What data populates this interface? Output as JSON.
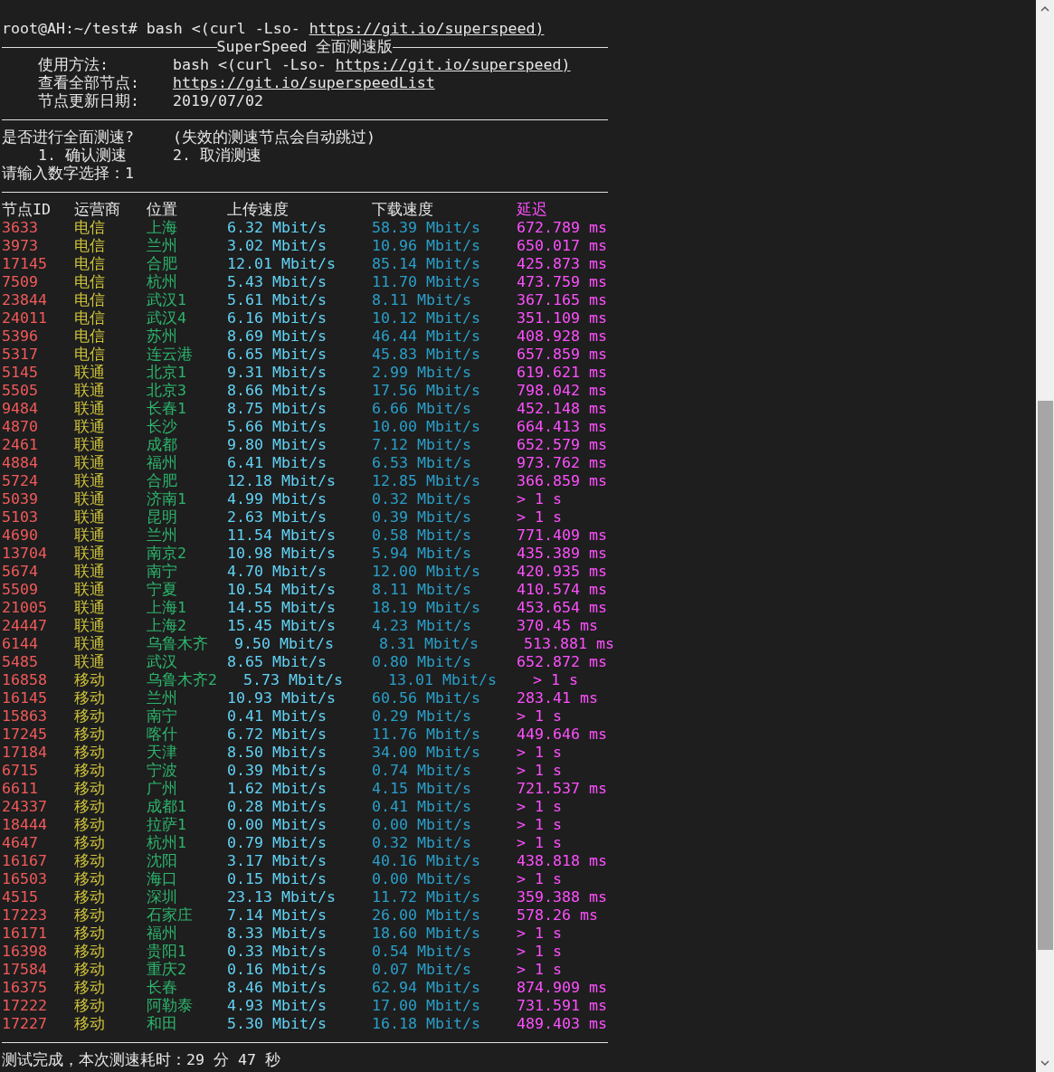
{
  "prompt_line": {
    "command": "root@AH:~/test# bash <(curl -Lso- ",
    "link": "https://git.io/superspeed)"
  },
  "banner_title": "SuperSpeed 全面测速版",
  "info": [
    {
      "label": "使用方法:",
      "value": "bash <(curl -Lso- ",
      "link": "https://git.io/superspeed)"
    },
    {
      "label": "查看全部节点:",
      "link": "https://git.io/superspeedList"
    },
    {
      "label": "节点更新日期:",
      "value": "2019/07/02"
    }
  ],
  "question": {
    "text": "是否进行全面测速?",
    "note": "(失效的测速节点会自动跳过)"
  },
  "options": [
    "1. 确认测速",
    "2. 取消测速"
  ],
  "input_prompt": {
    "label": "请输入数字选择：",
    "value": "1"
  },
  "table": {
    "columns": [
      "节点ID",
      "运营商",
      "位置",
      "上传速度",
      "下载速度",
      "延迟"
    ],
    "rows": [
      [
        "3633",
        "电信",
        "上海",
        "6.32 Mbit/s",
        "58.39 Mbit/s",
        "672.789 ms"
      ],
      [
        "3973",
        "电信",
        "兰州",
        "3.02 Mbit/s",
        "10.96 Mbit/s",
        "650.017 ms"
      ],
      [
        "17145",
        "电信",
        "合肥",
        "12.01 Mbit/s",
        "85.14 Mbit/s",
        "425.873 ms"
      ],
      [
        "7509",
        "电信",
        "杭州",
        "5.43 Mbit/s",
        "11.70 Mbit/s",
        "473.759 ms"
      ],
      [
        "23844",
        "电信",
        "武汉1",
        "5.61 Mbit/s",
        "8.11 Mbit/s",
        "367.165 ms"
      ],
      [
        "24011",
        "电信",
        "武汉4",
        "6.16 Mbit/s",
        "10.12 Mbit/s",
        "351.109 ms"
      ],
      [
        "5396",
        "电信",
        "苏州",
        "8.69 Mbit/s",
        "46.44 Mbit/s",
        "408.928 ms"
      ],
      [
        "5317",
        "电信",
        "连云港",
        "6.65 Mbit/s",
        "45.83 Mbit/s",
        "657.859 ms"
      ],
      [
        "5145",
        "联通",
        "北京1",
        "9.31 Mbit/s",
        "2.99 Mbit/s",
        "619.621 ms"
      ],
      [
        "5505",
        "联通",
        "北京3",
        "8.66 Mbit/s",
        "17.56 Mbit/s",
        "798.042 ms"
      ],
      [
        "9484",
        "联通",
        "长春1",
        "8.75 Mbit/s",
        "6.66 Mbit/s",
        "452.148 ms"
      ],
      [
        "4870",
        "联通",
        "长沙",
        "5.66 Mbit/s",
        "10.00 Mbit/s",
        "664.413 ms"
      ],
      [
        "2461",
        "联通",
        "成都",
        "9.80 Mbit/s",
        "7.12 Mbit/s",
        "652.579 ms"
      ],
      [
        "4884",
        "联通",
        "福州",
        "6.41 Mbit/s",
        "6.53 Mbit/s",
        "973.762 ms"
      ],
      [
        "5724",
        "联通",
        "合肥",
        "12.18 Mbit/s",
        "12.85 Mbit/s",
        "366.859 ms"
      ],
      [
        "5039",
        "联通",
        "济南1",
        "4.99 Mbit/s",
        "0.32 Mbit/s",
        "> 1 s"
      ],
      [
        "5103",
        "联通",
        "昆明",
        "2.63 Mbit/s",
        "0.39 Mbit/s",
        "> 1 s"
      ],
      [
        "4690",
        "联通",
        "兰州",
        "11.54 Mbit/s",
        "0.58 Mbit/s",
        "771.409 ms"
      ],
      [
        "13704",
        "联通",
        "南京2",
        "10.98 Mbit/s",
        "5.94 Mbit/s",
        "435.389 ms"
      ],
      [
        "5674",
        "联通",
        "南宁",
        "4.70 Mbit/s",
        "12.00 Mbit/s",
        "420.935 ms"
      ],
      [
        "5509",
        "联通",
        "宁夏",
        "10.54 Mbit/s",
        "8.11 Mbit/s",
        "410.574 ms"
      ],
      [
        "21005",
        "联通",
        "上海1",
        "14.55 Mbit/s",
        "18.19 Mbit/s",
        "453.654 ms"
      ],
      [
        "24447",
        "联通",
        "上海2",
        "15.45 Mbit/s",
        "4.23 Mbit/s",
        "370.45 ms"
      ],
      [
        "6144",
        "联通",
        "乌鲁木齐",
        "9.50 Mbit/s",
        "8.31 Mbit/s",
        "513.881 ms"
      ],
      [
        "5485",
        "联通",
        "武汉",
        "8.65 Mbit/s",
        "0.80 Mbit/s",
        "652.872 ms"
      ],
      [
        "16858",
        "移动",
        "乌鲁木齐2",
        "5.73 Mbit/s",
        "13.01 Mbit/s",
        "> 1 s"
      ],
      [
        "16145",
        "移动",
        "兰州",
        "10.93 Mbit/s",
        "60.56 Mbit/s",
        "283.41 ms"
      ],
      [
        "15863",
        "移动",
        "南宁",
        "0.41 Mbit/s",
        "0.29 Mbit/s",
        "> 1 s"
      ],
      [
        "17245",
        "移动",
        "喀什",
        "6.72 Mbit/s",
        "11.76 Mbit/s",
        "449.646 ms"
      ],
      [
        "17184",
        "移动",
        "天津",
        "8.50 Mbit/s",
        "34.00 Mbit/s",
        "> 1 s"
      ],
      [
        "6715",
        "移动",
        "宁波",
        "0.39 Mbit/s",
        "0.74 Mbit/s",
        "> 1 s"
      ],
      [
        "6611",
        "移动",
        "广州",
        "1.62 Mbit/s",
        "4.15 Mbit/s",
        "721.537 ms"
      ],
      [
        "24337",
        "移动",
        "成都1",
        "0.28 Mbit/s",
        "0.41 Mbit/s",
        "> 1 s"
      ],
      [
        "18444",
        "移动",
        "拉萨1",
        "0.00 Mbit/s",
        "0.00 Mbit/s",
        "> 1 s"
      ],
      [
        "4647",
        "移动",
        "杭州1",
        "0.79 Mbit/s",
        "0.32 Mbit/s",
        "> 1 s"
      ],
      [
        "16167",
        "移动",
        "沈阳",
        "3.17 Mbit/s",
        "40.16 Mbit/s",
        "438.818 ms"
      ],
      [
        "16503",
        "移动",
        "海口",
        "0.15 Mbit/s",
        "0.00 Mbit/s",
        "> 1 s"
      ],
      [
        "4515",
        "移动",
        "深圳",
        "23.13 Mbit/s",
        "11.72 Mbit/s",
        "359.388 ms"
      ],
      [
        "17223",
        "移动",
        "石家庄",
        "7.14 Mbit/s",
        "26.00 Mbit/s",
        "578.26 ms"
      ],
      [
        "16171",
        "移动",
        "福州",
        "8.33 Mbit/s",
        "18.60 Mbit/s",
        "> 1 s"
      ],
      [
        "16398",
        "移动",
        "贵阳1",
        "0.33 Mbit/s",
        "0.54 Mbit/s",
        "> 1 s"
      ],
      [
        "17584",
        "移动",
        "重庆2",
        "0.16 Mbit/s",
        "0.07 Mbit/s",
        "> 1 s"
      ],
      [
        "16375",
        "移动",
        "长春",
        "8.46 Mbit/s",
        "62.94 Mbit/s",
        "874.909 ms"
      ],
      [
        "17222",
        "移动",
        "阿勒泰",
        "4.93 Mbit/s",
        "17.00 Mbit/s",
        "731.591 ms"
      ],
      [
        "17227",
        "移动",
        "和田",
        "5.30 Mbit/s",
        "16.18 Mbit/s",
        "489.403 ms"
      ]
    ]
  },
  "summary": "测试完成，本次测速耗时：29 分 47 秒"
}
